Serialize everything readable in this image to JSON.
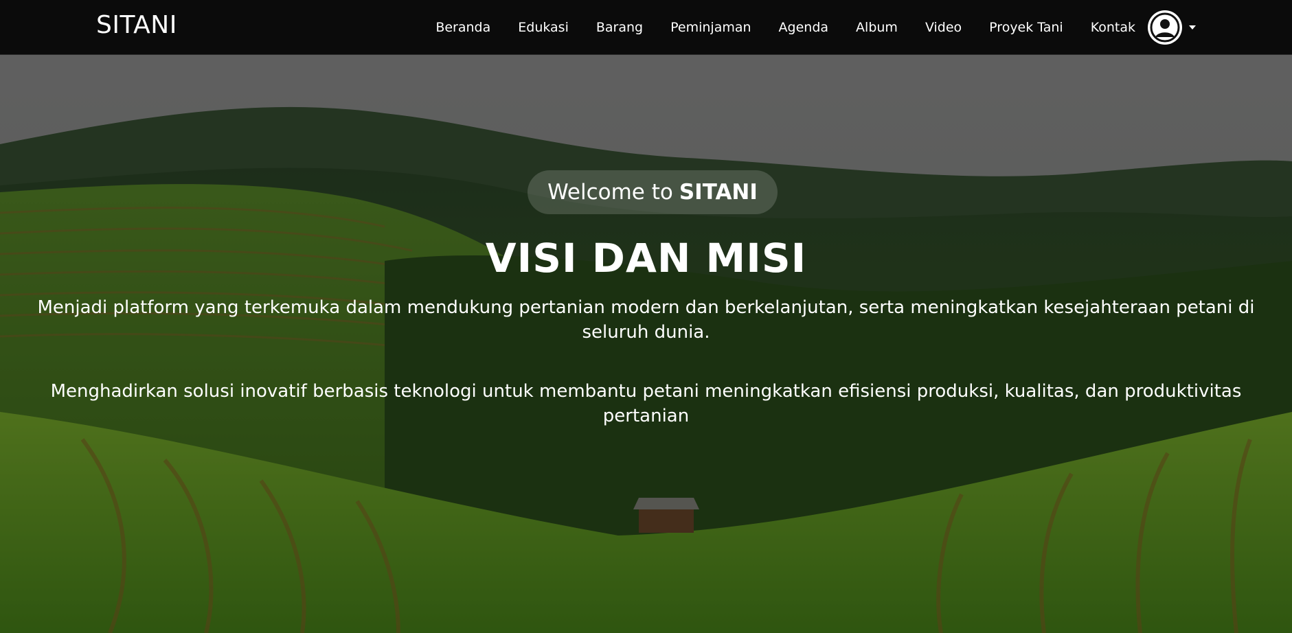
{
  "brand": "SITANI",
  "nav": {
    "items": [
      {
        "label": "Beranda"
      },
      {
        "label": "Edukasi"
      },
      {
        "label": "Barang"
      },
      {
        "label": "Peminjaman"
      },
      {
        "label": "Agenda"
      },
      {
        "label": "Album"
      },
      {
        "label": "Video"
      },
      {
        "label": "Proyek Tani"
      },
      {
        "label": "Kontak"
      }
    ],
    "user_icon": "user-circle-icon",
    "dropdown_icon": "caret-down-icon"
  },
  "hero": {
    "welcome_prefix": "Welcome to",
    "welcome_brand": "SITANI",
    "title": "VISI DAN MISI",
    "vision": "Menjadi platform yang terkemuka dalam mendukung pertanian modern dan berkelanjutan, serta meningkatkan kesejahteraan petani di seluruh dunia.",
    "mission": "Menghadirkan solusi inovatif berbasis teknologi untuk membantu petani meningkatkan efisiensi produksi, kualitas, dan produktivitas pertanian"
  },
  "colors": {
    "navbar_bg": "#0b0b0b",
    "text": "#ffffff",
    "field_green": "#4f8a1c",
    "sky": "#6a6a6a"
  }
}
